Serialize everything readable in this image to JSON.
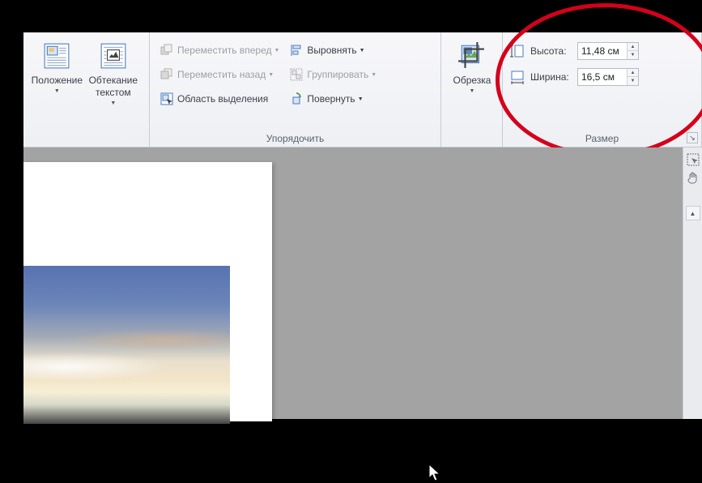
{
  "ribbon": {
    "position_label": "Положение",
    "wrap_label": "Обтекание текстом",
    "arrange_group": "Упорядочить",
    "bring_forward": "Переместить вперед",
    "send_backward": "Переместить назад",
    "selection_pane": "Область выделения",
    "align": "Выровнять",
    "group_btn": "Группировать",
    "rotate": "Повернуть",
    "crop_label": "Обрезка",
    "size_group": "Размер",
    "height_label": "Высота:",
    "width_label": "Ширина:",
    "height_value": "11,48 см",
    "width_value": "16,5 см"
  }
}
